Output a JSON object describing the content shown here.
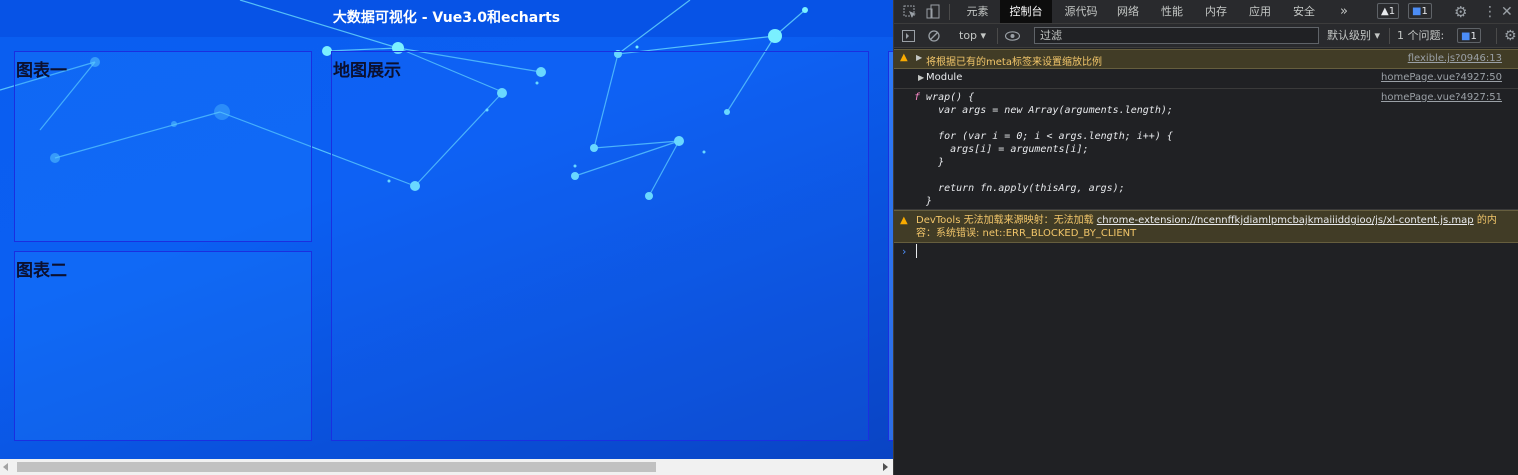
{
  "app": {
    "title": "大数据可视化 - Vue3.0和echarts",
    "panels": {
      "chart1_title": "图表一",
      "chart2_title": "图表二",
      "map_title": "地图展示"
    }
  },
  "devtools": {
    "tabs": [
      "元素",
      "控制台",
      "源代码",
      "网络",
      "性能",
      "内存",
      "应用",
      "安全"
    ],
    "active_tab": "控制台",
    "more": "»",
    "warnings_count": "1",
    "messages_count": "1",
    "toolbar": {
      "context": "top",
      "filter_placeholder": "过滤",
      "level": "默认级别",
      "issues_label": "1 个问题:",
      "issues_count": "1"
    },
    "console": {
      "msg1_text": "将根据已有的meta标签来设置缩放比例",
      "msg1_source": "flexible.js?0946:13",
      "msg2_text": "Module",
      "msg2_source": "homePage.vue?4927:50",
      "msg3_source": "homePage.vue?4927:51",
      "msg3_code": "f wrap() {\n    var args = new Array(arguments.length);\n\n    for (var i = 0; i < args.length; i++) {\n      args[i] = arguments[i];\n    }\n\n    return fn.apply(thisArg, args);\n  }",
      "msg4_line1_prefix": "DevTools 无法加载来源映射：无法加载 ",
      "msg4_link": "chrome-extension://ncennffkjdiamlpmcbajkmaiiiddgioo/js/xl-content.js.map",
      "msg4_line2_suffix": " 的内容：系统错误: net::ERR_BLOCKED_BY_CLIENT"
    }
  },
  "colors": {
    "app_bg": "#0b5ff2",
    "panel_border": "#1a2fe0",
    "devtools_bg": "#202124",
    "warning_bg": "#413c26",
    "warning_text": "#f2c66a"
  }
}
